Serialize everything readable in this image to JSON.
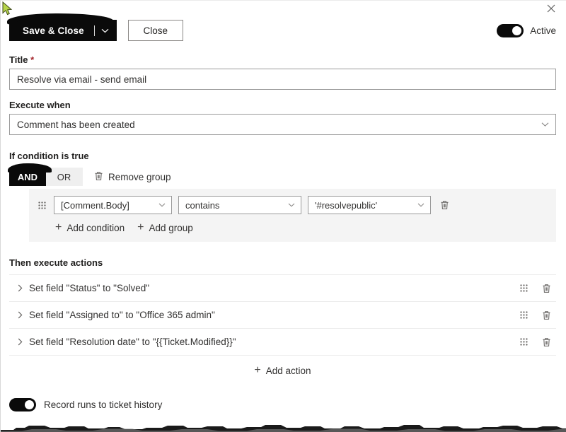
{
  "window": {
    "close_icon": "close-icon"
  },
  "toolbar": {
    "save_label": "Save & Close",
    "save_caret_icon": "chevron-down-icon",
    "close_label": "Close",
    "active_label": "Active",
    "active_on": true
  },
  "form": {
    "title_label": "Title",
    "title_required_marker": "*",
    "title_value": "Resolve via email - send email",
    "title_placeholder": "Enter a title",
    "execute_when_label": "Execute when",
    "execute_when_value": "Comment has been created",
    "execute_when_chevron_icon": "chevron-down-icon"
  },
  "condition": {
    "section_label": "If condition is true",
    "and_label": "AND",
    "or_label": "OR",
    "remove_group_label": "Remove group",
    "remove_group_icon": "trash-icon",
    "drag_icon": "drag-handle-icon",
    "rows": [
      {
        "field": "[Comment.Body]",
        "operator": "contains",
        "value": "'#resolvepublic'",
        "delete_icon": "trash-icon"
      }
    ],
    "add_condition_label": "Add condition",
    "add_group_label": "Add group",
    "plus_icon": "plus-icon"
  },
  "actions": {
    "section_label": "Then execute actions",
    "expand_icon": "chevron-right-icon",
    "drag_icon": "drag-handle-icon",
    "delete_icon": "trash-icon",
    "rows": [
      {
        "text": "Set field \"Status\" to \"Solved\""
      },
      {
        "text": "Set field \"Assigned to\" to \"Office 365 admin\""
      },
      {
        "text": "Set field \"Resolution date\" to \"{{Ticket.Modified}}\""
      }
    ],
    "add_action_label": "Add action",
    "plus_icon": "plus-icon"
  },
  "footer": {
    "record_runs_label": "Record runs to ticket history",
    "record_runs_on": true
  },
  "colors": {
    "accent": "#0a0a0a",
    "required": "#a4262c",
    "group_background": "#f4f4f4",
    "border": "#9a9a9a"
  }
}
